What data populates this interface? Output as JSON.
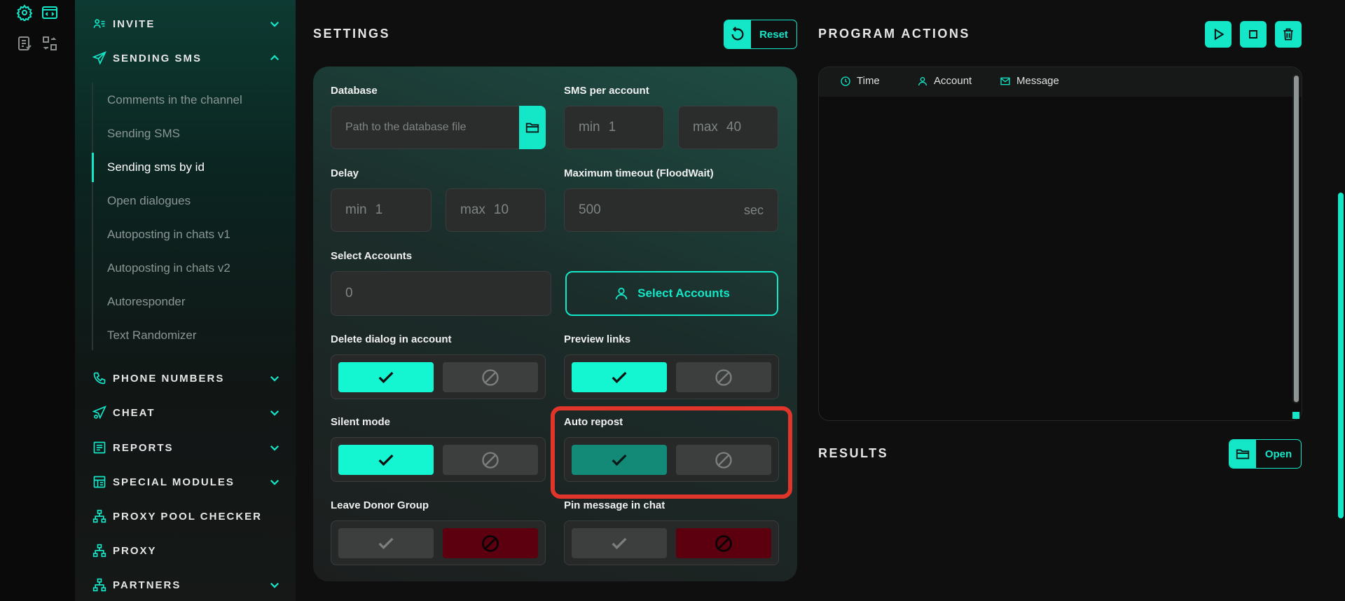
{
  "rail": {
    "icons": [
      "settings-gear-icon",
      "code-window-icon",
      "checklist-icon",
      "swap-icon"
    ]
  },
  "sidebar": {
    "sections": [
      {
        "label": "INVITE",
        "icon": "user-list-icon",
        "expanded": false
      },
      {
        "label": "SENDING SMS",
        "icon": "paper-plane-icon",
        "expanded": true
      },
      {
        "label": "PHONE NUMBERS",
        "icon": "phone-icon",
        "expanded": false
      },
      {
        "label": "CHEAT",
        "icon": "plane-gear-icon",
        "expanded": false
      },
      {
        "label": "REPORTS",
        "icon": "report-icon",
        "expanded": false
      },
      {
        "label": "SPECIAL MODULES",
        "icon": "modules-icon",
        "expanded": false
      },
      {
        "label": "PROXY POOL CHECKER",
        "icon": "network-icon"
      },
      {
        "label": "PROXY",
        "icon": "network-icon"
      },
      {
        "label": "PARTNERS",
        "icon": "network-icon",
        "expanded": false
      }
    ],
    "sub_items": [
      "Comments in the channel",
      "Sending SMS",
      "Sending sms by id",
      "Open dialogues",
      "Autoposting in chats v1",
      "Autoposting in chats v2",
      "Autoresponder",
      "Text Randomizer"
    ],
    "active_sub_item": "Sending sms by id"
  },
  "settings": {
    "title": "SETTINGS",
    "reset_label": "Reset",
    "database": {
      "label": "Database",
      "placeholder": "Path to the database file"
    },
    "sms_per_account": {
      "label": "SMS per account",
      "min_prefix": "min",
      "min_value": "1",
      "max_prefix": "max",
      "max_value": "40"
    },
    "delay": {
      "label": "Delay",
      "min_prefix": "min",
      "min_value": "1",
      "max_prefix": "max",
      "max_value": "10"
    },
    "max_timeout": {
      "label": "Maximum timeout (FloodWait)",
      "value": "500",
      "unit": "sec"
    },
    "select_accounts": {
      "label": "Select Accounts",
      "value": "0",
      "button_label": "Select Accounts"
    },
    "toggles": {
      "delete_dialog": {
        "label": "Delete dialog in account",
        "state": "on"
      },
      "preview_links": {
        "label": "Preview links",
        "state": "on"
      },
      "silent_mode": {
        "label": "Silent mode",
        "state": "on"
      },
      "auto_repost": {
        "label": "Auto repost",
        "state": "on"
      },
      "leave_donor": {
        "label": "Leave Donor Group",
        "state": "off"
      },
      "pin_message": {
        "label": "Pin message in chat",
        "state": "off"
      }
    }
  },
  "program_actions": {
    "title": "PROGRAM ACTIONS",
    "columns": [
      "Time",
      "Account",
      "Message"
    ]
  },
  "results": {
    "title": "RESULTS",
    "open_label": "Open"
  },
  "colors": {
    "accent": "#14e6c8",
    "highlight": "#e0352b",
    "off_red": "#5c0010"
  }
}
